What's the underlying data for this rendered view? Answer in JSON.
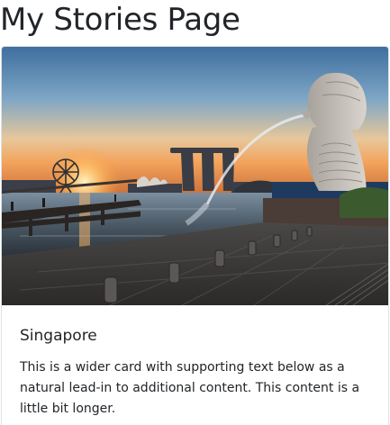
{
  "page": {
    "title": "My Stories Page"
  },
  "card": {
    "image_alt": "Singapore skyline at sunset with the Merlion statue",
    "title": "Singapore",
    "text": "This is a wider card with supporting text below as a natural lead-in to additional content. This content is a little bit longer."
  }
}
